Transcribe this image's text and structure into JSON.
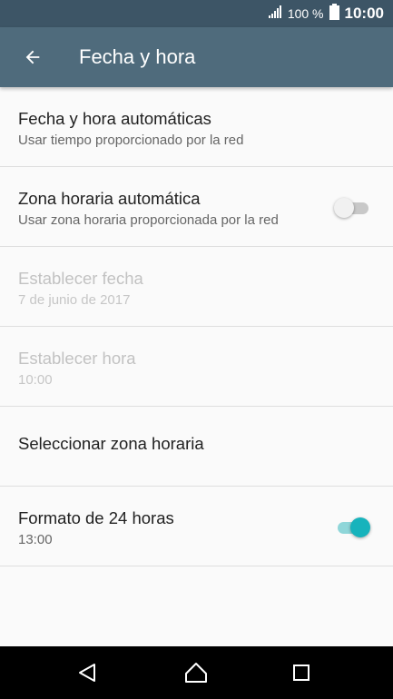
{
  "status_bar": {
    "signal_icon": "signal-icon",
    "battery_percent": "100 %",
    "battery_icon": "battery-icon",
    "time": "10:00"
  },
  "app_bar": {
    "back_icon": "back-arrow-icon",
    "title": "Fecha y hora"
  },
  "settings": [
    {
      "title": "Fecha y hora automáticas",
      "summary": "Usar tiempo proporcionado por la red"
    },
    {
      "title": "Zona horaria automática",
      "summary": "Usar zona horaria proporcionada por la red",
      "switch": "off"
    },
    {
      "title": "Establecer fecha",
      "summary": "7 de junio de 2017",
      "disabled": true
    },
    {
      "title": "Establecer hora",
      "summary": "10:00",
      "disabled": true
    },
    {
      "title": "Seleccionar zona horaria"
    },
    {
      "title": "Formato de 24 horas",
      "summary": "13:00",
      "switch": "on"
    }
  ],
  "colors": {
    "status_bar": "#3d5566",
    "app_bar": "#4f6b7c",
    "accent": "#17b3bc",
    "background": "#fafafa"
  },
  "nav_bar": {
    "back_icon": "nav-back-icon",
    "home_icon": "nav-home-icon",
    "recents_icon": "nav-recents-icon"
  }
}
